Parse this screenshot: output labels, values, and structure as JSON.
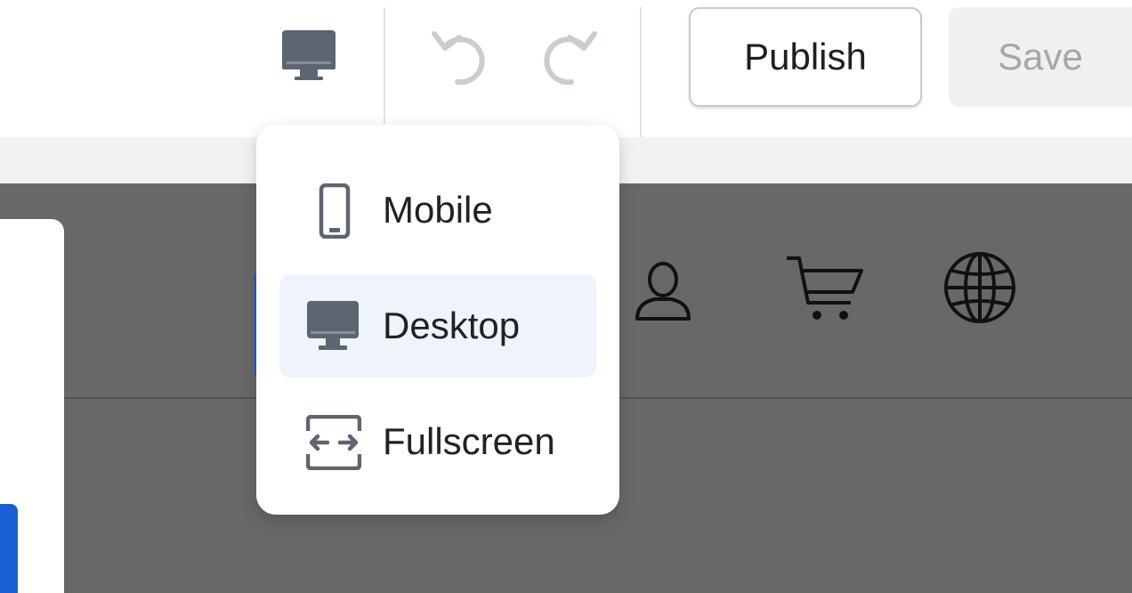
{
  "toolbar": {
    "device_icon": "desktop-icon",
    "undo_icon": "undo-icon",
    "redo_icon": "redo-icon",
    "publish_label": "Publish",
    "save_label": "Save"
  },
  "device_menu": {
    "items": [
      {
        "label": "Mobile",
        "icon": "mobile-icon",
        "selected": false
      },
      {
        "label": "Desktop",
        "icon": "desktop-icon",
        "selected": true
      },
      {
        "label": "Fullscreen",
        "icon": "fullscreen-icon",
        "selected": false
      }
    ]
  },
  "preview_header_icons": [
    "user-icon",
    "cart-icon",
    "globe-icon"
  ],
  "colors": {
    "accent": "#1a5fd6",
    "selected_bg": "#eff4fc",
    "canvas_bg": "#686868"
  }
}
